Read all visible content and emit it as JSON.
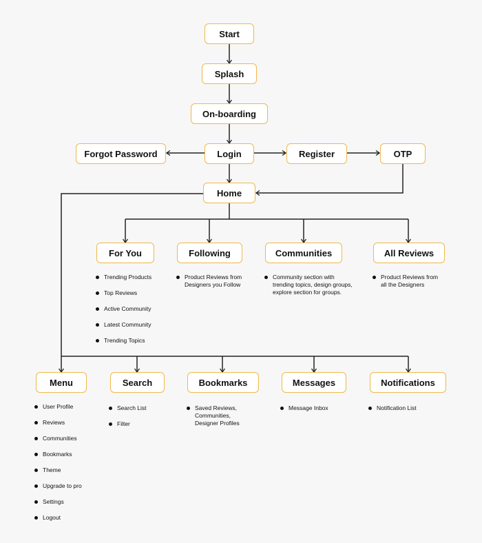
{
  "diagram": {
    "type": "app-flowchart",
    "colors": {
      "node_border": "#efb84a",
      "node_fill": "#ffffff",
      "line": "#222222",
      "background": "#f7f7f7"
    },
    "nodes": {
      "start": "Start",
      "splash": "Splash",
      "onboarding": "On-boarding",
      "login": "Login",
      "forgot_password": "Forgot Password",
      "register": "Register",
      "otp": "OTP",
      "home": "Home",
      "for_you": "For You",
      "following": "Following",
      "communities": "Communities",
      "all_reviews": "All Reviews",
      "menu": "Menu",
      "search": "Search",
      "bookmarks": "Bookmarks",
      "messages": "Messages",
      "notifications": "Notifications"
    },
    "edges": [
      [
        "Start",
        "Splash"
      ],
      [
        "Splash",
        "On-boarding"
      ],
      [
        "On-boarding",
        "Login"
      ],
      [
        "Login",
        "Forgot Password"
      ],
      [
        "Login",
        "Register"
      ],
      [
        "Register",
        "OTP"
      ],
      [
        "OTP",
        "Home"
      ],
      [
        "Login",
        "Home"
      ],
      [
        "Home",
        "For You"
      ],
      [
        "Home",
        "Following"
      ],
      [
        "Home",
        "Communities"
      ],
      [
        "Home",
        "All Reviews"
      ],
      [
        "Home",
        "Menu"
      ],
      [
        "Home",
        "Search"
      ],
      [
        "Home",
        "Bookmarks"
      ],
      [
        "Home",
        "Messages"
      ],
      [
        "Home",
        "Notifications"
      ]
    ],
    "notes": {
      "for_you": [
        "Trending Products",
        "Top Reviews",
        "Active Community",
        "Latest Community",
        "Trending Topics"
      ],
      "following": [
        "Product Reviews from Designers you Follow"
      ],
      "communities": [
        "Community section with trending topics, design groups, explore section for groups."
      ],
      "all_reviews": [
        "Product Reviews from all the Designers"
      ],
      "menu": [
        "User Profile",
        "Reviews",
        "Communities",
        "Bookmarks",
        "Theme",
        "Upgrade to pro",
        "Settings",
        "Logout"
      ],
      "search": [
        "Search List",
        "Filter"
      ],
      "bookmarks": [
        "Saved Reviews, Communities, Designer Profiles"
      ],
      "messages": [
        "Message Inbox"
      ],
      "notifications": [
        "Notification List"
      ]
    }
  }
}
